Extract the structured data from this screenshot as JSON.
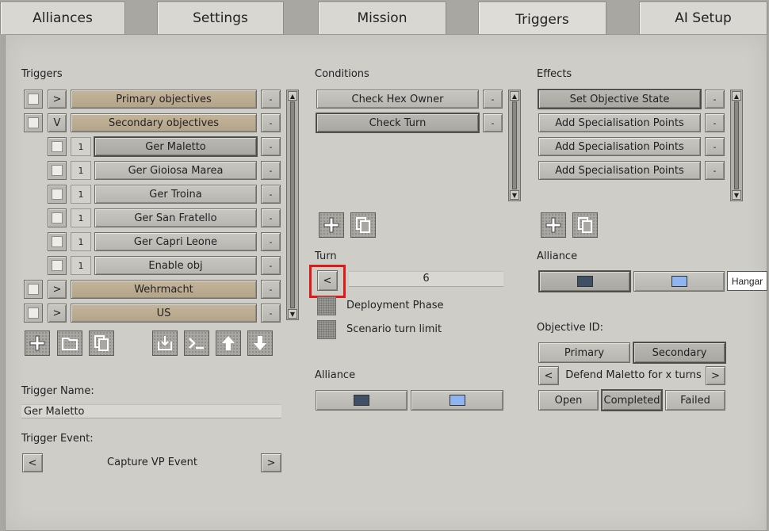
{
  "tabs": [
    "Alliances",
    "Settings",
    "Mission",
    "Triggers",
    "AI Setup"
  ],
  "triggers": {
    "label": "Triggers",
    "rows": [
      {
        "toggle": ">",
        "num": "",
        "name": "Primary objectives",
        "style": "tan"
      },
      {
        "toggle": "V",
        "num": "",
        "name": "Secondary objectives",
        "style": "tan"
      },
      {
        "toggle": "",
        "num": "1",
        "name": "Ger Maletto",
        "style": "dark"
      },
      {
        "toggle": "",
        "num": "1",
        "name": "Ger Gioiosa Marea",
        "style": "gray"
      },
      {
        "toggle": "",
        "num": "1",
        "name": "Ger Troina",
        "style": "gray"
      },
      {
        "toggle": "",
        "num": "1",
        "name": "Ger San Fratello",
        "style": "gray"
      },
      {
        "toggle": "",
        "num": "1",
        "name": "Ger Capri Leone",
        "style": "gray"
      },
      {
        "toggle": "",
        "num": "1",
        "name": "Enable obj",
        "style": "gray"
      },
      {
        "toggle": ">",
        "num": "",
        "name": "Wehrmacht",
        "style": "tan"
      },
      {
        "toggle": ">",
        "num": "",
        "name": "US",
        "style": "tan"
      }
    ],
    "remove_label": "-"
  },
  "trigger_name": {
    "label": "Trigger Name:",
    "value": "Ger Maletto"
  },
  "trigger_event": {
    "label": "Trigger Event:",
    "prev": "<",
    "value": "Capture VP Event",
    "next": ">"
  },
  "conditions": {
    "label": "Conditions",
    "items": [
      "Check Hex Owner",
      "Check Turn"
    ],
    "remove_label": "-"
  },
  "turn": {
    "label": "Turn",
    "prev": "<",
    "value": "6",
    "options": [
      "Deployment Phase",
      "Scenario turn limit"
    ]
  },
  "condition_alliance": {
    "label": "Alliance",
    "colors": [
      "#3f4f66",
      "#8fb4f2"
    ]
  },
  "effects": {
    "label": "Effects",
    "items": [
      "Set Objective State",
      "Add Specialisation Points",
      "Add Specialisation Points",
      "Add Specialisation Points"
    ],
    "remove_label": "-"
  },
  "effect_alliance": {
    "label": "Alliance",
    "colors": [
      "#3f4f66",
      "#8fb4f2"
    ],
    "tooltip": "Hangar"
  },
  "objective": {
    "label": "Objective ID:",
    "types": [
      "Primary",
      "Secondary"
    ],
    "prev": "<",
    "name": "Defend Maletto for x turns",
    "next": ">",
    "states": [
      "Open",
      "Completed",
      "Failed"
    ]
  },
  "icons": {
    "add": "plus-icon",
    "folder": "folder-icon",
    "copy": "copy-icon",
    "import": "import-icon",
    "console": "console-icon",
    "up": "arrow-up-icon",
    "down": "arrow-down-icon"
  },
  "colors": {
    "highlight": "#e01818",
    "tan": "#c3b49b"
  }
}
